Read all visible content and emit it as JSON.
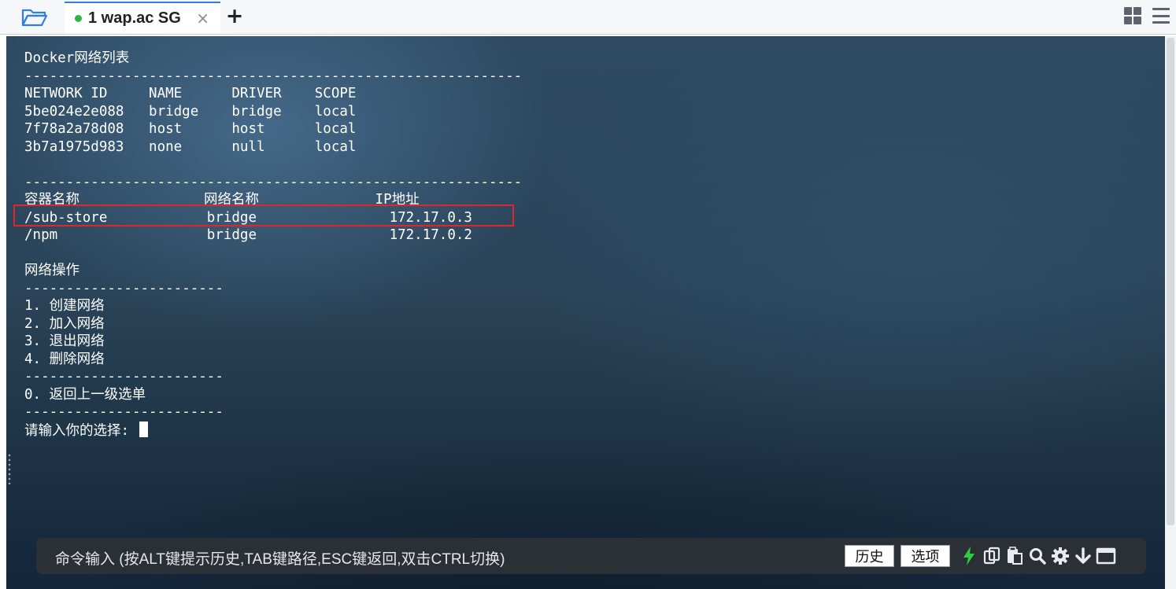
{
  "tabbar": {
    "tab_label": "1 wap.ac SG",
    "tab_status_color": "#2fb541",
    "close_glyph": "×",
    "add_glyph": "+"
  },
  "terminal": {
    "lines": [
      "Docker网络列表",
      "------------------------------------------------------------",
      "NETWORK ID     NAME      DRIVER    SCOPE",
      "5be024e2e088   bridge    bridge    local",
      "7f78a2a78d08   host      host      local",
      "3b7a1975d983   none      null      local",
      "",
      "------------------------------------------------------------",
      "容器名称               网络名称              IP地址",
      "/sub-store            bridge                172.17.0.3",
      "/npm                  bridge                172.17.0.2",
      "",
      "网络操作",
      "------------------------",
      "1. 创建网络",
      "2. 加入网络",
      "3. 退出网络",
      "4. 删除网络",
      "------------------------",
      "0. 返回上一级选单",
      "------------------------",
      "请输入你的选择: "
    ],
    "highlight_color": "#e0262c"
  },
  "cmdbar": {
    "hint": "命令输入 (按ALT键提示历史,TAB键路径,ESC键返回,双击CTRL切换)",
    "history_label": "历史",
    "options_label": "选项",
    "icons": [
      "lightning-icon",
      "copy-icon",
      "paste-icon",
      "search-icon",
      "gear-icon",
      "download-arrow-icon",
      "window-icon"
    ]
  }
}
